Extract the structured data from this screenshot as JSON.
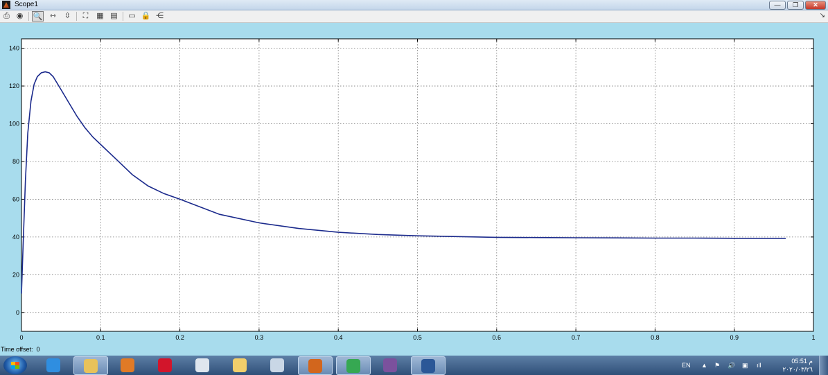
{
  "window": {
    "title": "Scope1",
    "buttons": {
      "minimize": "—",
      "maximize": "❐",
      "close": "✕"
    }
  },
  "toolbar": {
    "items": [
      {
        "name": "print-icon",
        "glyph": "⎙"
      },
      {
        "name": "parameters-icon",
        "glyph": "◉"
      },
      {
        "name": "zoom-icon",
        "glyph": "🔍",
        "active": true
      },
      {
        "name": "zoom-x-icon",
        "glyph": "⇿"
      },
      {
        "name": "zoom-y-icon",
        "glyph": "⇳"
      },
      {
        "name": "autoscale-icon",
        "glyph": "⛶"
      },
      {
        "name": "save-axes-icon",
        "glyph": "▦"
      },
      {
        "name": "restore-axes-icon",
        "glyph": "▤"
      },
      {
        "name": "floating-scope-icon",
        "glyph": "▭"
      },
      {
        "name": "lock-axes-icon",
        "glyph": "🔒"
      },
      {
        "name": "signal-selector-icon",
        "glyph": "⋲"
      }
    ],
    "end_glyph": "↘"
  },
  "chart_data": {
    "type": "line",
    "xlim": [
      0,
      1
    ],
    "ylim": [
      -10,
      145
    ],
    "xticks": [
      "0",
      "0.1",
      "0.2",
      "0.3",
      "0.4",
      "0.5",
      "0.6",
      "0.7",
      "0.8",
      "0.9",
      "1"
    ],
    "yticks": [
      "0",
      "20",
      "40",
      "60",
      "80",
      "100",
      "120",
      "140"
    ],
    "grid": true,
    "series": [
      {
        "color": "#1b2a8c",
        "x": [
          0,
          0.002,
          0.005,
          0.008,
          0.012,
          0.016,
          0.02,
          0.025,
          0.03,
          0.035,
          0.04,
          0.05,
          0.06,
          0.07,
          0.08,
          0.09,
          0.1,
          0.12,
          0.14,
          0.16,
          0.18,
          0.2,
          0.25,
          0.3,
          0.35,
          0.4,
          0.45,
          0.5,
          0.55,
          0.6,
          0.65,
          0.7,
          0.75,
          0.8,
          0.85,
          0.9,
          0.93,
          0.965
        ],
        "y": [
          10,
          35,
          70,
          95,
          112,
          121,
          125,
          127,
          127.5,
          127,
          125,
          118,
          111,
          104,
          98,
          93,
          89,
          81,
          73,
          67,
          63,
          60,
          52,
          47.5,
          44.5,
          42.5,
          41.3,
          40.6,
          40.2,
          39.8,
          39.7,
          39.6,
          39.5,
          39.4,
          39.4,
          39.3,
          39.3,
          39.3
        ]
      }
    ]
  },
  "status": {
    "offset_label": "Time offset:",
    "offset_value": "0"
  },
  "taskbar": {
    "apps": [
      {
        "name": "internet-explorer-icon",
        "color": "#2f8ee0"
      },
      {
        "name": "file-explorer-icon",
        "color": "#e8c25a"
      },
      {
        "name": "media-player-icon",
        "color": "#e07a26"
      },
      {
        "name": "opera-icon",
        "color": "#d2152b"
      },
      {
        "name": "remote-desktop-icon",
        "color": "#dfe6ee"
      },
      {
        "name": "paint-icon",
        "color": "#f2cf6b"
      },
      {
        "name": "calculator-icon",
        "color": "#c9d7e6"
      },
      {
        "name": "matlab-icon",
        "color": "#d2661d"
      },
      {
        "name": "chrome-icon",
        "color": "#36a852"
      },
      {
        "name": "viber-icon",
        "color": "#7b519d"
      },
      {
        "name": "word-icon",
        "color": "#2b5797"
      }
    ],
    "lang": "EN",
    "time": "05:51 م",
    "date": "٢٠٢٠/٠٣/٢٦"
  }
}
